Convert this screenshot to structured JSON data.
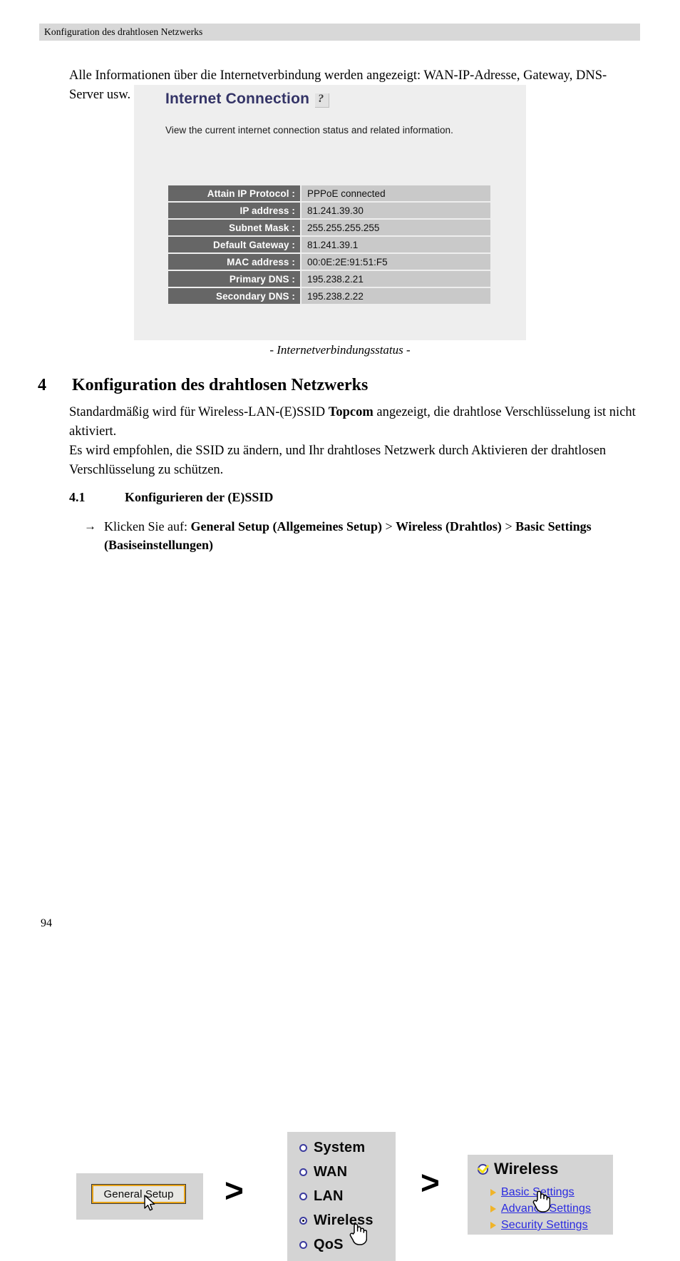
{
  "header": {
    "running_title": "Konfiguration des drahtlosen Netzwerks"
  },
  "intro": {
    "paragraph": "Alle Informationen über die Internetverbindung werden angezeigt: WAN-IP-Adresse, Gateway, DNS-Server usw."
  },
  "screenshot": {
    "title": "Internet Connection",
    "help_icon": "question-mark-icon",
    "description": "View the current internet connection status and related information.",
    "table": {
      "rows": [
        {
          "label": "Attain IP Protocol :",
          "value": "PPPoE connected"
        },
        {
          "label": "IP address :",
          "value": "81.241.39.30"
        },
        {
          "label": "Subnet Mask :",
          "value": "255.255.255.255"
        },
        {
          "label": "Default Gateway :",
          "value": "81.241.39.1"
        },
        {
          "label": "MAC address :",
          "value": "00:0E:2E:91:51:F5"
        },
        {
          "label": "Primary DNS :",
          "value": "195.238.2.21"
        },
        {
          "label": "Secondary DNS :",
          "value": "195.238.2.22"
        }
      ]
    },
    "caption": "- Internetverbindungsstatus -"
  },
  "chapter": {
    "number": "4",
    "title": "Konfiguration des drahtlosen Netzwerks",
    "body_line1_a": "Standardmäßig wird für Wireless-LAN-(E)SSID ",
    "body_line1_bold": "Topcom",
    "body_line1_b": " angezeigt, die drahtlose Verschlüsselung ist nicht aktiviert.",
    "body_line2": "Es wird empfohlen, die SSID zu ändern, und Ihr drahtloses Netzwerk durch Aktivieren der drahtlosen Verschlüsselung zu schützen."
  },
  "subsection": {
    "number": "4.1",
    "title": "Konfigurieren der (E)SSID",
    "step_arrow": "→",
    "step_prefix": "Klicken Sie auf: ",
    "step_b1": "General Setup (Allgemeines Setup)",
    "step_sep1": " > ",
    "step_b2": "Wireless (Drahtlos)",
    "step_sep2": " > ",
    "step_b3": "Basic Settings (Basiseinstellungen)"
  },
  "widgets": {
    "general_setup_button": "General Setup",
    "chevron_1": ">",
    "chevron_2": ">",
    "menu": {
      "items": [
        {
          "label": "System",
          "selected": false
        },
        {
          "label": "WAN",
          "selected": false
        },
        {
          "label": "LAN",
          "selected": false
        },
        {
          "label": "Wireless",
          "selected": true
        },
        {
          "label": "QoS",
          "selected": false
        }
      ]
    },
    "wireless_panel": {
      "title": "Wireless",
      "links": [
        "Basic Settings",
        "Advance Settings",
        "Security Settings"
      ]
    }
  },
  "footer": {
    "page_number": "94"
  },
  "colors": {
    "header_band": "#d8d8d8",
    "panel_bg": "#eeeeee",
    "title_blue": "#333366",
    "row_label_bg": "#666666",
    "row_value_bg": "#c9c9c9",
    "widget_bg": "#d4d4d4",
    "link_blue": "#2a2ae0",
    "bullet_orange": "#f0b429",
    "button_border": "#e8a317",
    "radio_blue": "#3b3b9e",
    "check_yellow": "#f2e017"
  }
}
